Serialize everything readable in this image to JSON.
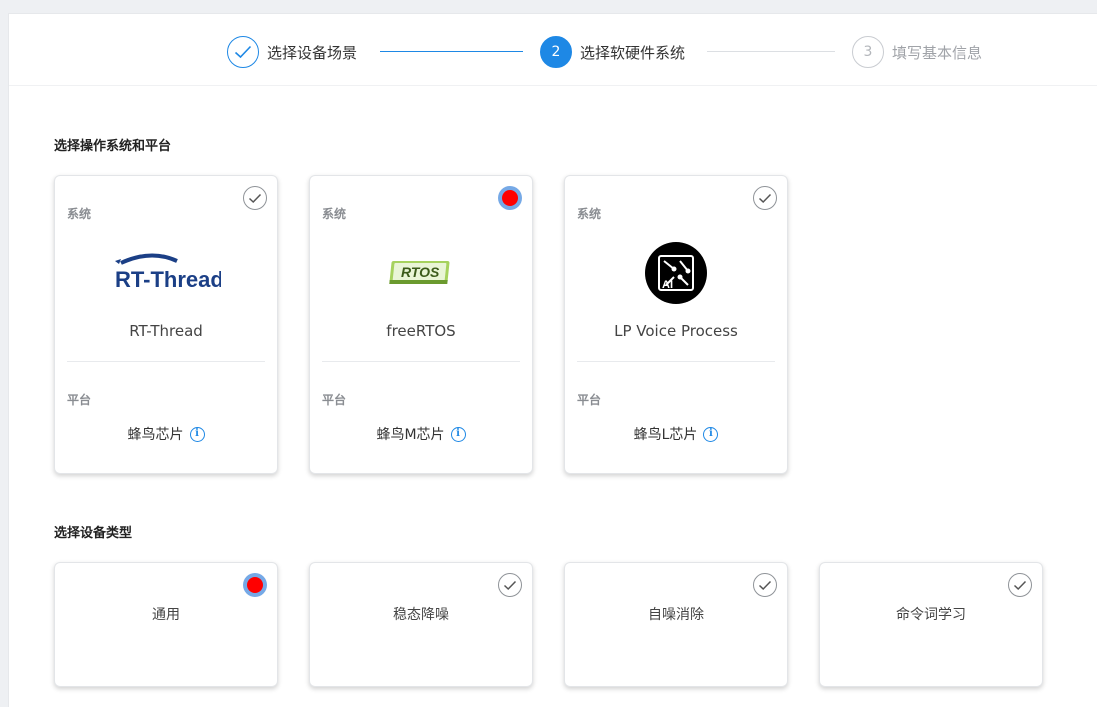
{
  "stepper": {
    "steps": [
      {
        "number": "",
        "label": "选择设备场景",
        "state": "done"
      },
      {
        "number": "2",
        "label": "选择软硬件系统",
        "state": "active"
      },
      {
        "number": "3",
        "label": "填写基本信息",
        "state": "pending"
      }
    ]
  },
  "os_section": {
    "title": "选择操作系统和平台",
    "system_label": "系统",
    "platform_label": "平台",
    "cards": [
      {
        "name": "RT-Thread",
        "logo_text": "RT-Thread",
        "platform": "蜂鸟芯片",
        "selected": false
      },
      {
        "name": "freeRTOS",
        "logo_text": "RTOS",
        "platform": "蜂鸟M芯片",
        "selected": true
      },
      {
        "name": "LP Voice Process",
        "logo_text": "AI",
        "platform": "蜂鸟L芯片",
        "selected": false
      }
    ]
  },
  "device_section": {
    "title": "选择设备类型",
    "cards": [
      {
        "name": "通用",
        "selected": true
      },
      {
        "name": "稳态降噪",
        "selected": false
      },
      {
        "name": "自噪消除",
        "selected": false
      },
      {
        "name": "命令词学习",
        "selected": false
      }
    ]
  },
  "colors": {
    "accent": "#1e88e5",
    "selected_dot": "#ff0000",
    "selected_ring": "#76a9e6"
  }
}
